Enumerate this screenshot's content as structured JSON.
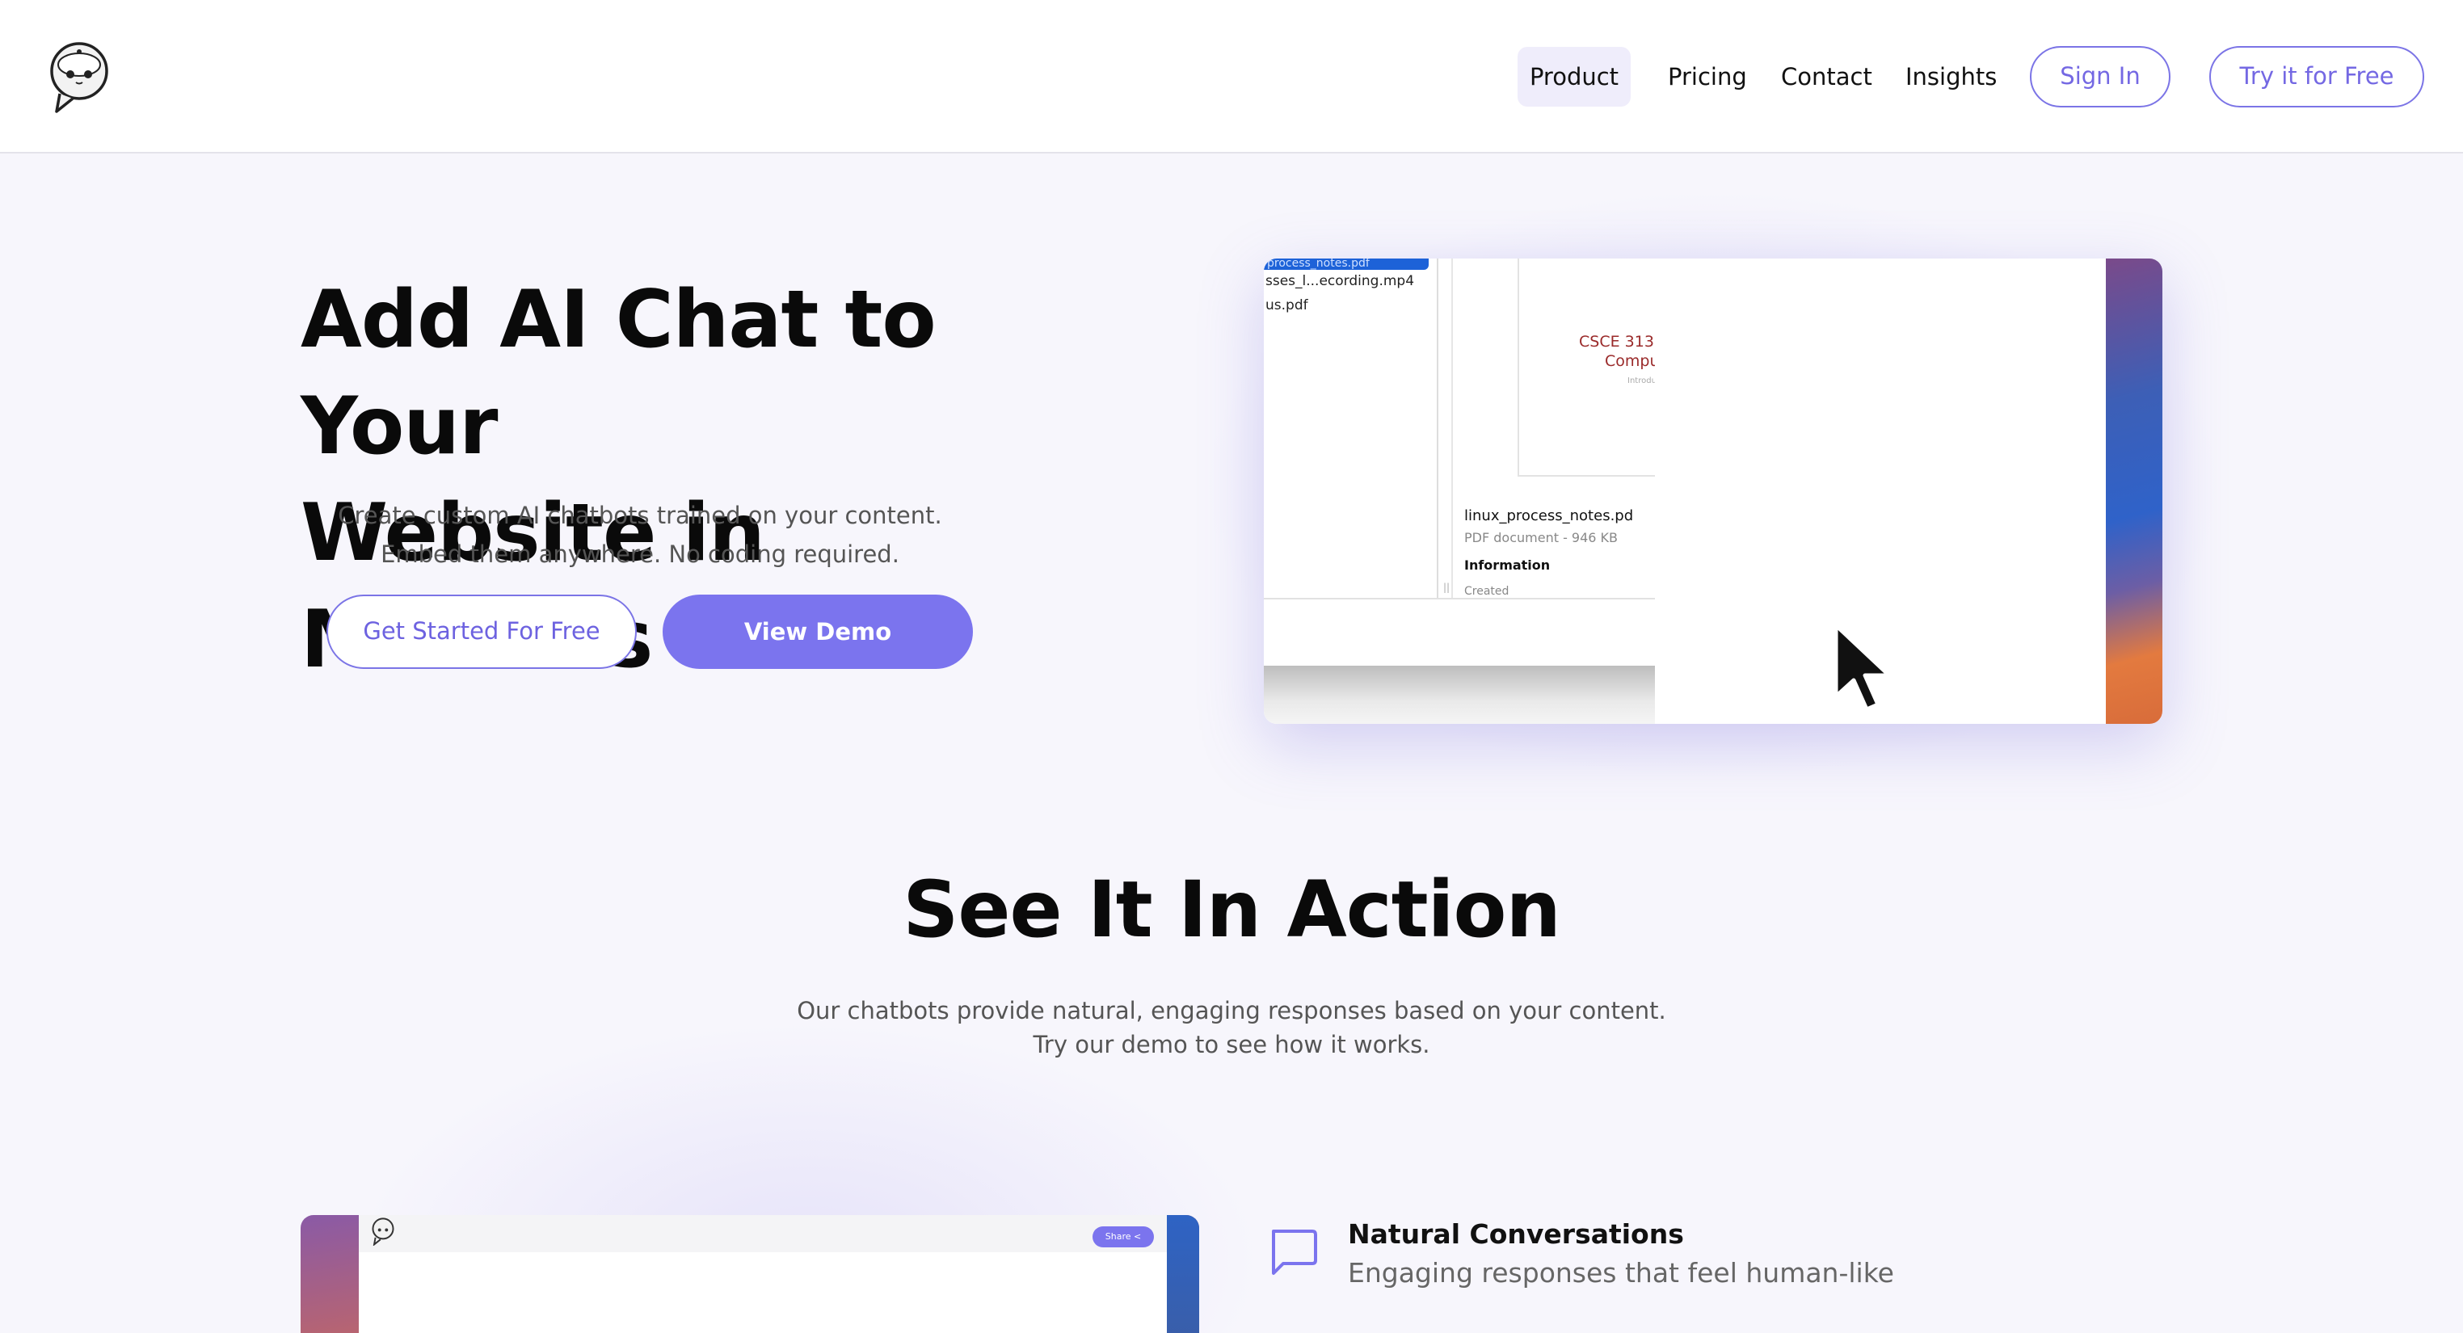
{
  "header": {
    "logo_name": "chatbot-logo",
    "nav": {
      "product": "Product",
      "pricing": "Pricing",
      "contact": "Contact",
      "insights": "Insights"
    },
    "sign_in": "Sign In",
    "try_free": "Try it for Free"
  },
  "hero": {
    "title_line1": "Add AI Chat to Your",
    "title_line2": "Website in Minutes",
    "subtitle_line1": "Create custom AI chatbots trained on your content.",
    "subtitle_line2": "Embed them anywhere. No coding required.",
    "cta_primary": "Get Started For Free",
    "cta_secondary": "View Demo"
  },
  "hero_preview": {
    "selected_file": "process_notes.pdf",
    "files": [
      "sses_l...ecording.mp4",
      "us.pdf"
    ],
    "pdf_heading_1": "CSCE 313",
    "pdf_heading_2": "Compu",
    "pdf_heading_3": "Introdu",
    "file_name": "linux_process_notes.pd",
    "file_meta": "PDF document - 946 KB",
    "info_label": "Information",
    "created_label": "Created"
  },
  "section": {
    "title": "See It In Action",
    "subtitle_line1": "Our chatbots provide natural, engaging responses based on your content.",
    "subtitle_line2": "Try our demo to see how it works."
  },
  "demo_preview": {
    "share_label": "Share"
  },
  "feature": {
    "icon": "chat-bubble-icon",
    "title": "Natural Conversations",
    "description": "Engaging responses that feel human-like"
  },
  "colors": {
    "accent": "#7b74ee",
    "accent_text": "#6d62e0",
    "background": "#f7f6fc"
  }
}
